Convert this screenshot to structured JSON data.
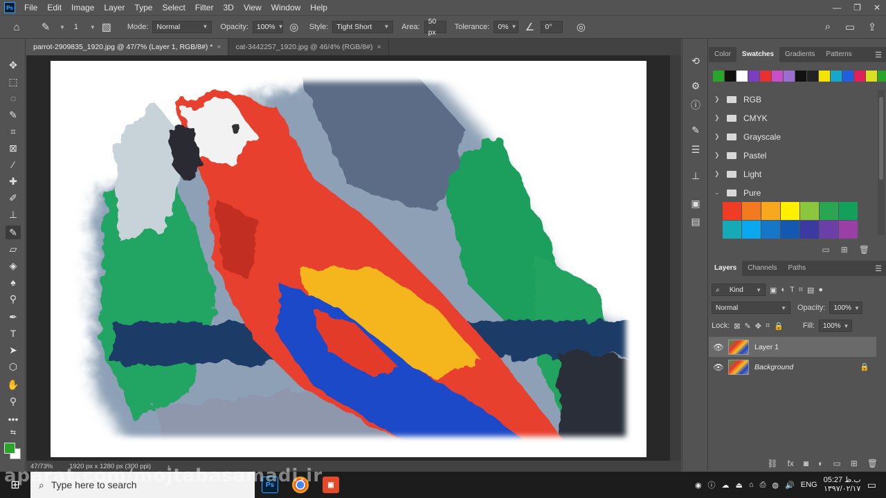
{
  "menubar": {
    "logo": "Ps",
    "items": [
      "File",
      "Edit",
      "Image",
      "Layer",
      "Type",
      "Select",
      "Filter",
      "3D",
      "View",
      "Window",
      "Help"
    ],
    "controls": [
      "—",
      "❐",
      "✕"
    ]
  },
  "options": {
    "brush_size": "1",
    "mode_label": "Mode:",
    "mode_value": "Normal",
    "opacity_label": "Opacity:",
    "opacity_value": "100%",
    "style_label": "Style:",
    "style_value": "Tight Short",
    "area_label": "Area:",
    "area_value": "50 px",
    "tolerance_label": "Tolerance:",
    "tolerance_value": "0%",
    "angle_value": "0°"
  },
  "tabs": [
    {
      "label": "parrot-2909835_1920.jpg @ 47/7% (Layer 1, RGB/8#) *"
    },
    {
      "label": "cat-3442257_1920.jpg @ 46/4% (RGB/8#)"
    }
  ],
  "status": {
    "zoom": "47/73%",
    "dimensions": "1920 px x 1280 px (300 ppi)"
  },
  "swatches": {
    "tabs": [
      "Color",
      "Swatches",
      "Gradients",
      "Patterns"
    ],
    "active_tab": "Swatches",
    "recent": [
      "#2aa52a",
      "#111111",
      "#ffffff",
      "#7a3fbf",
      "#e83030",
      "#c84fc8",
      "#9b6fd0",
      "#111111",
      "#222222",
      "#f5e400",
      "#18a7c8",
      "#2060e0",
      "#e0205a",
      "#d8e020",
      "#2aa52a"
    ],
    "folders": [
      {
        "label": "RGB",
        "expanded": false
      },
      {
        "label": "CMYK",
        "expanded": false
      },
      {
        "label": "Grayscale",
        "expanded": false
      },
      {
        "label": "Pastel",
        "expanded": false
      },
      {
        "label": "Light",
        "expanded": false
      },
      {
        "label": "Pure",
        "expanded": true
      }
    ],
    "pure": [
      "#f03c24",
      "#f47a20",
      "#f7a81c",
      "#fff000",
      "#8cc63e",
      "#2aa653",
      "#12a05a",
      "#16a9b6",
      "#0aa8ee",
      "#1677c8",
      "#1458b0",
      "#3a3aa0",
      "#6c3fa8",
      "#9a3fa6"
    ]
  },
  "layers": {
    "tabs": [
      "Layers",
      "Channels",
      "Paths"
    ],
    "active_tab": "Layers",
    "filter_label": "Kind",
    "blend_mode": "Normal",
    "opacity_label": "Opacity:",
    "opacity_value": "100%",
    "lock_label": "Lock:",
    "fill_label": "Fill:",
    "fill_value": "100%",
    "items": [
      {
        "name": "Layer 1",
        "selected": true,
        "locked": false
      },
      {
        "name": "Background",
        "selected": false,
        "locked": true
      }
    ]
  },
  "taskbar": {
    "search_placeholder": "Type here to search",
    "language": "ENG",
    "time": "05:27 ب.ظ",
    "date": "۱۳۹۷/۰۲/۱۷"
  },
  "watermark": "aparat.com/mojtabasamadi.ir"
}
